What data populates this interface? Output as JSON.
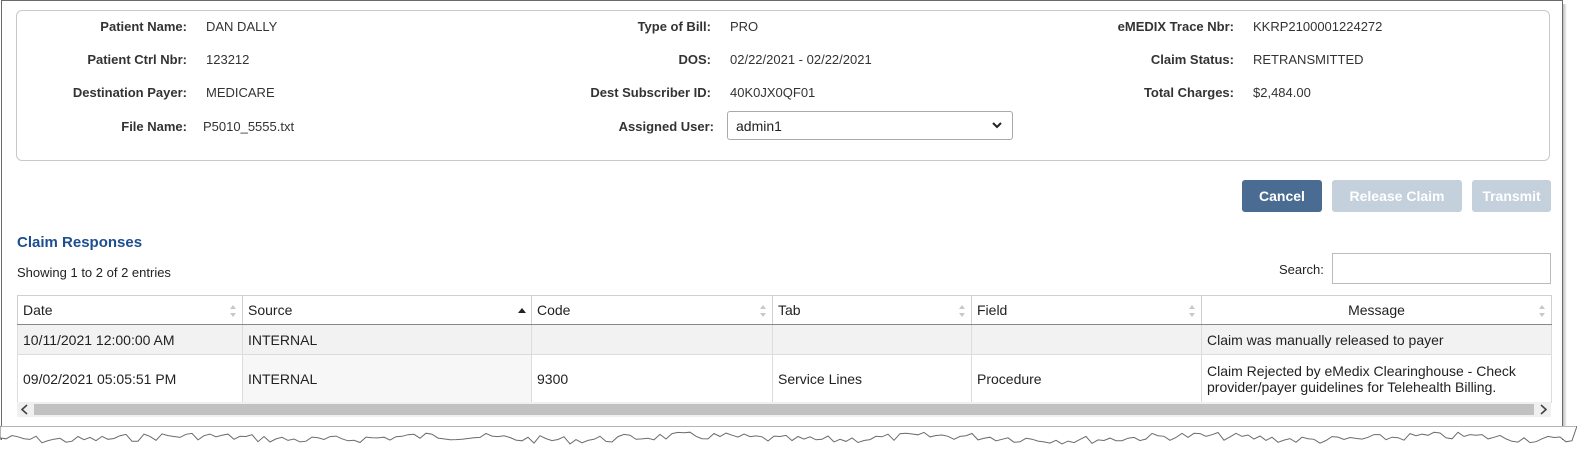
{
  "claim": {
    "patient_name_label": "Patient Name:",
    "patient_name": "DAN  DALLY",
    "patient_ctrl_label": "Patient Ctrl Nbr:",
    "patient_ctrl": "123212",
    "dest_payer_label": "Destination Payer:",
    "dest_payer": "MEDICARE",
    "file_name_label": "File Name:",
    "file_name": "P5010_5555.txt",
    "bill_type_label": "Type of Bill:",
    "bill_type": "PRO",
    "dos_label": "DOS:",
    "dos": "02/22/2021 - 02/22/2021",
    "dest_sub_label": "Dest Subscriber ID:",
    "dest_sub": "40K0JX0QF01",
    "assigned_user_label": "Assigned User:",
    "assigned_user": "admin1",
    "trace_label": "eMEDIX Trace Nbr:",
    "trace": "KKRP2100001224272",
    "status_label": "Claim Status:",
    "status": "RETRANSMITTED",
    "charges_label": "Total Charges:",
    "charges": "$2,484.00"
  },
  "actions": {
    "cancel": "Cancel",
    "release": "Release Claim",
    "transmit": "Transmit"
  },
  "responses": {
    "title": "Claim Responses",
    "showing": "Showing 1 to 2 of 2 entries",
    "search_label": "Search:",
    "columns": [
      "Date",
      "Source",
      "Code",
      "Tab",
      "Field",
      "Message"
    ],
    "rows": [
      {
        "date": "10/11/2021 12:00:00 AM",
        "source": "INTERNAL",
        "code": "",
        "tab": "",
        "field": "",
        "message": "Claim was manually released to payer"
      },
      {
        "date": "09/02/2021 05:05:51 PM",
        "source": "INTERNAL",
        "code": "9300",
        "tab": "Service Lines",
        "field": "Procedure",
        "message": "Claim Rejected by eMedix Clearinghouse - Check provider/payer guidelines for Telehealth Billing."
      }
    ]
  },
  "colors": {
    "primary_button": "#4a6c92",
    "disabled_button": "#c4d0dc",
    "section_title": "#1d4e8f"
  },
  "icons": {
    "dropdown": "chevron-down-icon",
    "sort": "sort-both-icon",
    "sort_asc": "sort-asc-icon",
    "scroll_left": "arrow-left-icon",
    "scroll_right": "arrow-right-icon"
  }
}
